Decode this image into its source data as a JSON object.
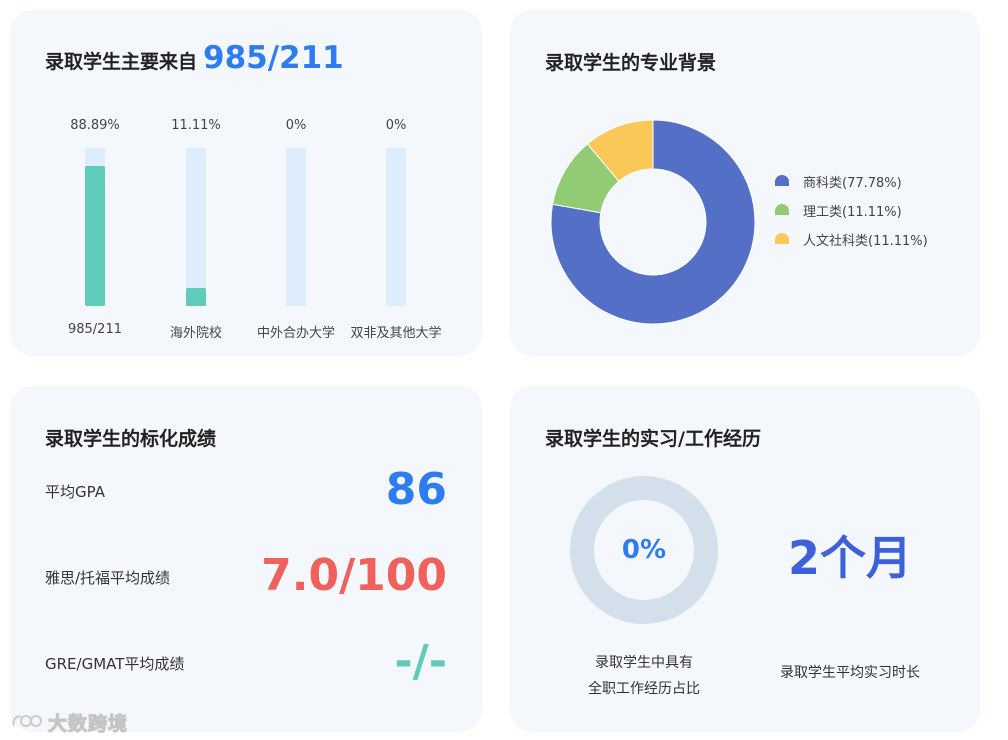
{
  "source_card": {
    "title_prefix": "录取学生主要来自",
    "title_highlight": "985/211",
    "bars": [
      {
        "percent_label": "88.89%",
        "value": 88.89,
        "label": "985/211"
      },
      {
        "percent_label": "11.11%",
        "value": 11.11,
        "label": "海外院校"
      },
      {
        "percent_label": "0%",
        "value": 0,
        "label": "中外合办大学"
      },
      {
        "percent_label": "0%",
        "value": 0,
        "label": "双非及其他大学"
      }
    ]
  },
  "major_card": {
    "title": "录取学生的专业背景",
    "legend": [
      {
        "label": "商科类(77.78%)"
      },
      {
        "label": "理工类(11.11%)"
      },
      {
        "label": "人文社科类(11.11%)"
      }
    ]
  },
  "chart_data": {
    "type": "pie",
    "donut": true,
    "slices": [
      {
        "name": "商科类",
        "value": 77.78,
        "color": "#5470c6"
      },
      {
        "name": "理工类",
        "value": 11.11,
        "color": "#91cc75"
      },
      {
        "name": "人文社科类",
        "value": 11.11,
        "color": "#fac858"
      }
    ],
    "legend_position": "right"
  },
  "scores_card": {
    "title": "录取学生的标化成绩",
    "rows": [
      {
        "label": "平均GPA",
        "value": "86",
        "color": "#2d7cf0"
      },
      {
        "label": "雅思/托福平均成绩",
        "value": "7.0/100",
        "color": "#f0605c"
      },
      {
        "label": "GRE/GMAT平均成绩",
        "value": "-/-",
        "color": "#5ecbbb"
      }
    ]
  },
  "experience_card": {
    "title": "录取学生的实习/工作经历",
    "ring_value": "0%",
    "ring_fraction": 0,
    "ring_caption_line1": "录取学生中具有",
    "ring_caption_line2": "全职工作经历占比",
    "duration_value": "2个月",
    "duration_caption": "录取学生平均实习时长"
  },
  "watermark": {
    "text": "大数跨境"
  }
}
